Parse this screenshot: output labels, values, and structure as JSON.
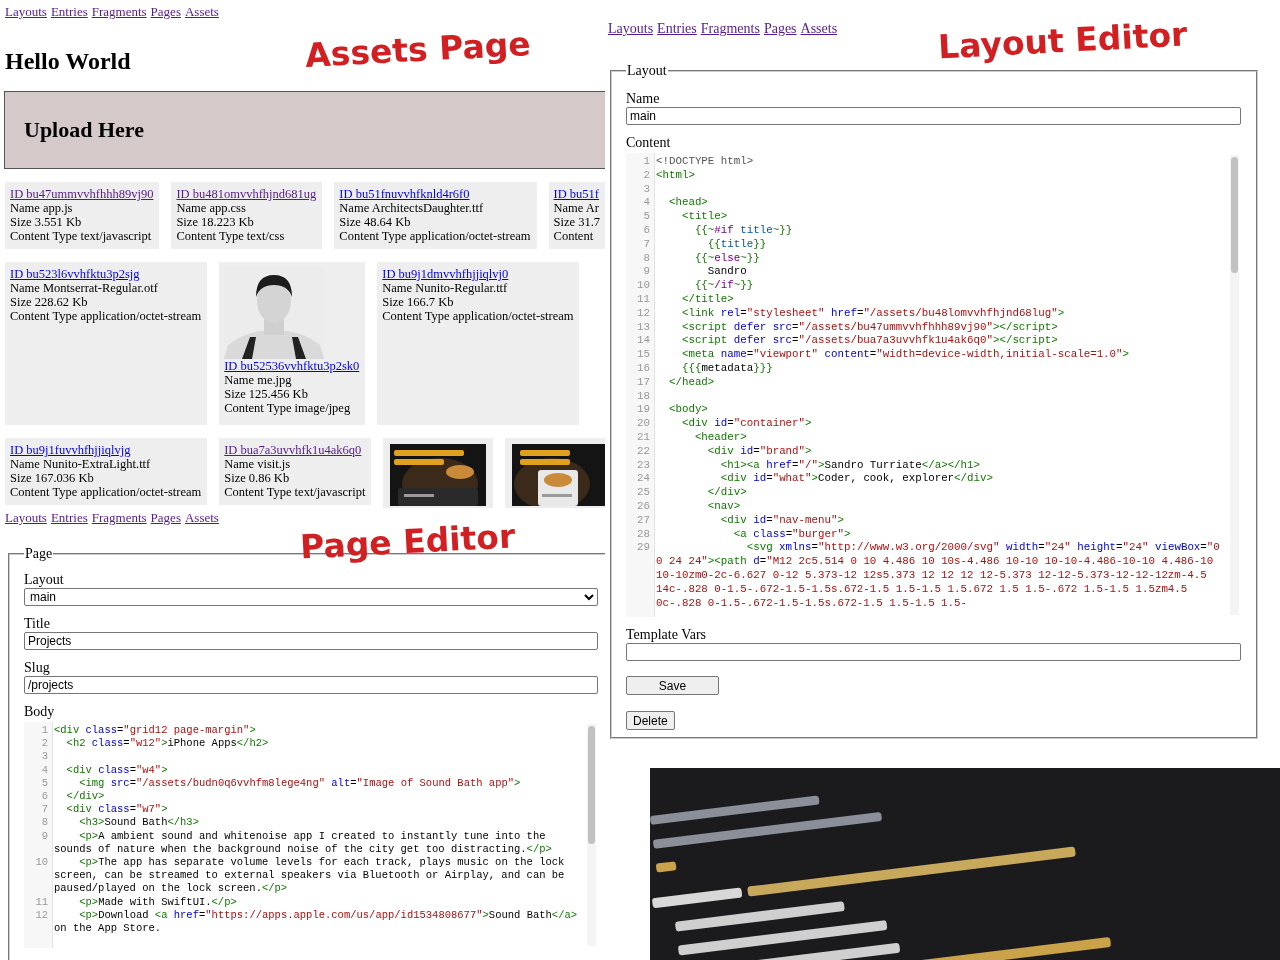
{
  "assets_page": {
    "nav": [
      "Layouts",
      "Entries",
      "Fragments",
      "Pages",
      "Assets"
    ],
    "annotation": "Assets Page",
    "heading": "Hello World",
    "upload_label": "Upload Here",
    "asset_rows": [
      [
        {
          "kind": "file",
          "id": "ID bu47ummvvhfhhh89vj90",
          "visited": true,
          "name": "Name app.js",
          "size": "Size 3.551 Kb",
          "content_type": "Content Type text/javascript"
        },
        {
          "kind": "file",
          "id": "ID bu481omvvhfhjnd681ug",
          "visited": true,
          "name": "Name app.css",
          "size": "Size 18.223 Kb",
          "content_type": "Content Type text/css"
        },
        {
          "kind": "file",
          "id": "ID bu51fnuvvhfknld4r6f0",
          "visited": false,
          "name": "Name ArchitectsDaughter.ttf",
          "size": "Size 48.64 Kb",
          "content_type": "Content Type application/octet-stream"
        },
        {
          "kind": "file",
          "id": "ID bu51f",
          "visited": false,
          "name": "Name Ar",
          "size": "Size 31.7",
          "content_type": "Content"
        }
      ],
      [
        {
          "kind": "file",
          "id": "ID bu523l6vvhfktu3p2sjg",
          "visited": false,
          "name": "Name Montserrat-Regular.otf",
          "size": "Size 228.62 Kb",
          "content_type": "Content Type application/octet-stream"
        },
        {
          "kind": "image_file",
          "id": "ID bu52536vvhfktu3p2sk0",
          "visited": false,
          "name": "Name me.jpg",
          "size": "Size 125.456 Kb",
          "content_type": "Content Type image/jpeg"
        },
        {
          "kind": "file",
          "id": "ID bu9j1dmvvhfhjjiqlvj0",
          "visited": false,
          "name": "Name Nunito-Regular.ttf",
          "size": "Size 166.7 Kb",
          "content_type": "Content Type application/octet-stream"
        }
      ],
      [
        {
          "kind": "file",
          "id": "ID bu9j1fuvvhfhjjiqlvjg",
          "visited": false,
          "name": "Name Nunito-ExtraLight.ttf",
          "size": "Size 167.036 Kb",
          "content_type": "Content Type application/octet-stream"
        },
        {
          "kind": "file",
          "id": "ID bua7a3uvvhfk1u4ak6q0",
          "visited": true,
          "name": "Name visit.js",
          "size": "Size 0.86 Kb",
          "content_type": "Content Type text/javascript"
        },
        {
          "kind": "picture"
        },
        {
          "kind": "picture"
        }
      ]
    ]
  },
  "layout_editor": {
    "nav": [
      "Layouts",
      "Entries",
      "Fragments",
      "Pages",
      "Assets"
    ],
    "annotation": "Layout Editor",
    "legend": "Layout",
    "name_label": "Name",
    "name_value": "main",
    "content_label": "Content",
    "content_lines": [
      {
        "number": "1",
        "tokens": [
          {
            "kind": "meta",
            "text": "<!DOCTYPE html>"
          }
        ]
      },
      {
        "number": "2",
        "tokens": [
          {
            "kind": "tag",
            "text": "<html>"
          }
        ]
      },
      {
        "number": "3"
      },
      {
        "number": "4",
        "tokens": [
          {
            "kind": "tag",
            "text": "  <head>"
          }
        ]
      },
      {
        "number": "5",
        "tokens": [
          {
            "kind": "tag",
            "text": "    <title>"
          }
        ]
      },
      {
        "number": "6",
        "tokens": [
          {
            "kind": "tag",
            "text": "      {{~"
          },
          {
            "kind": "keyword",
            "text": "#if"
          },
          {
            "kind": "variable",
            "text": " title"
          },
          {
            "kind": "tag",
            "text": "~}}"
          }
        ]
      },
      {
        "number": "7",
        "tokens": [
          {
            "kind": "tag",
            "text": "        {{"
          },
          {
            "kind": "variable",
            "text": "title"
          },
          {
            "kind": "tag",
            "text": "}}"
          }
        ]
      },
      {
        "number": "8",
        "tokens": [
          {
            "kind": "tag",
            "text": "      {{~"
          },
          {
            "kind": "keyword",
            "text": "else"
          },
          {
            "kind": "tag",
            "text": "~}}"
          }
        ]
      },
      {
        "number": "9",
        "tokens": [
          {
            "kind": "text",
            "text": "        Sandro"
          }
        ]
      },
      {
        "number": "10",
        "tokens": [
          {
            "kind": "tag",
            "text": "      {{~"
          },
          {
            "kind": "keyword",
            "text": "/if"
          },
          {
            "kind": "tag",
            "text": "~}}"
          }
        ]
      },
      {
        "number": "11",
        "tokens": [
          {
            "kind": "tag",
            "text": "    </title>"
          }
        ]
      },
      {
        "number": "12",
        "tokens": [
          {
            "kind": "tag",
            "text": "    <link"
          },
          {
            "kind": "attr",
            "text": " rel"
          },
          {
            "kind": "text",
            "text": "="
          },
          {
            "kind": "string",
            "text": "\"stylesheet\""
          },
          {
            "kind": "attr",
            "text": " href"
          },
          {
            "kind": "text",
            "text": "="
          },
          {
            "kind": "string",
            "text": "\"/assets/bu48lomvvhfhjnd68lug\""
          },
          {
            "kind": "tag",
            "text": ">"
          }
        ]
      },
      {
        "number": "13",
        "tokens": [
          {
            "kind": "tag",
            "text": "    <script"
          },
          {
            "kind": "attr",
            "text": " defer src"
          },
          {
            "kind": "text",
            "text": "="
          },
          {
            "kind": "string",
            "text": "\"/assets/bu47ummvvhfhhh89vj90\""
          },
          {
            "kind": "tag",
            "text": "></script>"
          }
        ]
      },
      {
        "number": "14",
        "tokens": [
          {
            "kind": "tag",
            "text": "    <script"
          },
          {
            "kind": "attr",
            "text": " defer src"
          },
          {
            "kind": "text",
            "text": "="
          },
          {
            "kind": "string",
            "text": "\"/assets/bua7a3uvvhfk1u4ak6q0\""
          },
          {
            "kind": "tag",
            "text": "></script>"
          }
        ]
      },
      {
        "number": "15",
        "tokens": [
          {
            "kind": "tag",
            "text": "    <meta"
          },
          {
            "kind": "attr",
            "text": " name"
          },
          {
            "kind": "text",
            "text": "="
          },
          {
            "kind": "string",
            "text": "\"viewport\""
          },
          {
            "kind": "attr",
            "text": " content"
          },
          {
            "kind": "text",
            "text": "="
          },
          {
            "kind": "string",
            "text": "\"width=device-width,initial-scale=1.0\""
          },
          {
            "kind": "tag",
            "text": ">"
          }
        ]
      },
      {
        "number": "16",
        "tokens": [
          {
            "kind": "tag",
            "text": "    {{{"
          },
          {
            "kind": "text",
            "text": "metadata"
          },
          {
            "kind": "tag",
            "text": "}}}"
          }
        ]
      },
      {
        "number": "17",
        "tokens": [
          {
            "kind": "tag",
            "text": "  </head>"
          }
        ]
      },
      {
        "number": "18"
      },
      {
        "number": "19",
        "tokens": [
          {
            "kind": "tag",
            "text": "  <body>"
          }
        ]
      },
      {
        "number": "20",
        "tokens": [
          {
            "kind": "tag",
            "text": "    <div"
          },
          {
            "kind": "attr",
            "text": " id"
          },
          {
            "kind": "text",
            "text": "="
          },
          {
            "kind": "string",
            "text": "\"container\""
          },
          {
            "kind": "tag",
            "text": ">"
          }
        ]
      },
      {
        "number": "21",
        "tokens": [
          {
            "kind": "tag",
            "text": "      <header>"
          }
        ]
      },
      {
        "number": "22",
        "tokens": [
          {
            "kind": "tag",
            "text": "        <div"
          },
          {
            "kind": "attr",
            "text": " id"
          },
          {
            "kind": "text",
            "text": "="
          },
          {
            "kind": "string",
            "text": "\"brand\""
          },
          {
            "kind": "tag",
            "text": ">"
          }
        ]
      },
      {
        "number": "23",
        "tokens": [
          {
            "kind": "tag",
            "text": "          <h1><a"
          },
          {
            "kind": "attr",
            "text": " href"
          },
          {
            "kind": "text",
            "text": "="
          },
          {
            "kind": "string",
            "text": "\"/\""
          },
          {
            "kind": "tag",
            "text": ">"
          },
          {
            "kind": "text",
            "text": "Sandro Turriate"
          },
          {
            "kind": "tag",
            "text": "</a></h1>"
          }
        ]
      },
      {
        "number": "24",
        "tokens": [
          {
            "kind": "tag",
            "text": "          <div"
          },
          {
            "kind": "attr",
            "text": " id"
          },
          {
            "kind": "text",
            "text": "="
          },
          {
            "kind": "string",
            "text": "\"what\""
          },
          {
            "kind": "tag",
            "text": ">"
          },
          {
            "kind": "text",
            "text": "Coder, cook, explorer"
          },
          {
            "kind": "tag",
            "text": "</div>"
          }
        ]
      },
      {
        "number": "25",
        "tokens": [
          {
            "kind": "tag",
            "text": "        </div>"
          }
        ]
      },
      {
        "number": "26",
        "tokens": [
          {
            "kind": "tag",
            "text": "        <nav>"
          }
        ]
      },
      {
        "number": "27",
        "tokens": [
          {
            "kind": "tag",
            "text": "          <div"
          },
          {
            "kind": "attr",
            "text": " id"
          },
          {
            "kind": "text",
            "text": "="
          },
          {
            "kind": "string",
            "text": "\"nav-menu\""
          },
          {
            "kind": "tag",
            "text": ">"
          }
        ]
      },
      {
        "number": "28",
        "tokens": [
          {
            "kind": "tag",
            "text": "            <a"
          },
          {
            "kind": "attr",
            "text": " class"
          },
          {
            "kind": "text",
            "text": "="
          },
          {
            "kind": "string",
            "text": "\"burger\""
          },
          {
            "kind": "tag",
            "text": ">"
          }
        ]
      },
      {
        "number": "29",
        "tokens": [
          {
            "kind": "tag",
            "text": "              <svg"
          },
          {
            "kind": "attr",
            "text": " xmlns"
          },
          {
            "kind": "text",
            "text": "="
          },
          {
            "kind": "string",
            "text": "\"http://www.w3.org/2000/svg\""
          },
          {
            "kind": "attr",
            "text": " width"
          },
          {
            "kind": "text",
            "text": "="
          },
          {
            "kind": "string",
            "text": "\"24\""
          },
          {
            "kind": "attr",
            "text": " height"
          },
          {
            "kind": "text",
            "text": "="
          },
          {
            "kind": "string",
            "text": "\"24\""
          },
          {
            "kind": "attr",
            "text": " viewBox"
          },
          {
            "kind": "text",
            "text": "="
          },
          {
            "kind": "string",
            "text": "\"0 0 24 24\""
          },
          {
            "kind": "tag",
            "text": "><path"
          },
          {
            "kind": "attr",
            "text": " d"
          },
          {
            "kind": "text",
            "text": "="
          },
          {
            "kind": "string",
            "text": "\"M12 2c5.514 0 10 4.486 10 10s-4.486 10-10 10-10-4.486-10-10 4.486-10 10-10zm0-2c-6.627 0-12 5.373-12 12s5.373 12 12 12 12-5.373 12-12-5.373-12-12-12zm-4.5 14c-.828 0-1.5-.672-1.5-1.5s.672-1.5 1.5-1.5 1.5.672 1.5 1.5-.672 1.5-1.5 1.5zm4.5 0c-.828 0-1.5-.672-1.5-1.5s.672-1.5 1.5-1.5 1.5-"
          }
        ]
      }
    ],
    "template_vars_label": "Template Vars",
    "buttons": [
      "Save",
      "Delete"
    ]
  },
  "page_editor": {
    "nav": [
      "Layouts",
      "Entries",
      "Fragments",
      "Pages",
      "Assets"
    ],
    "annotation": "Page Editor",
    "legend": "Page",
    "layout_label": "Layout",
    "layout_value": "main",
    "title_label": "Title",
    "title_value": "Projects",
    "slug_label": "Slug",
    "slug_value": "/projects",
    "body_label": "Body",
    "body_lines": [
      {
        "number": "1",
        "tokens": [
          {
            "kind": "tag",
            "text": "<div"
          },
          {
            "kind": "attr",
            "text": " class"
          },
          {
            "kind": "text",
            "text": "="
          },
          {
            "kind": "string",
            "text": "\"grid12 page-margin\""
          },
          {
            "kind": "tag",
            "text": ">"
          }
        ]
      },
      {
        "number": "2",
        "tokens": [
          {
            "kind": "tag",
            "text": "  <h2"
          },
          {
            "kind": "attr",
            "text": " class"
          },
          {
            "kind": "text",
            "text": "="
          },
          {
            "kind": "string",
            "text": "\"w12\""
          },
          {
            "kind": "tag",
            "text": ">"
          },
          {
            "kind": "text",
            "text": "iPhone Apps"
          },
          {
            "kind": "tag",
            "text": "</h2>"
          }
        ]
      },
      {
        "number": "3"
      },
      {
        "number": "4",
        "tokens": [
          {
            "kind": "tag",
            "text": "  <div"
          },
          {
            "kind": "attr",
            "text": " class"
          },
          {
            "kind": "text",
            "text": "="
          },
          {
            "kind": "string",
            "text": "\"w4\""
          },
          {
            "kind": "tag",
            "text": ">"
          }
        ]
      },
      {
        "number": "5",
        "tokens": [
          {
            "kind": "tag",
            "text": "    <img"
          },
          {
            "kind": "attr",
            "text": " src"
          },
          {
            "kind": "text",
            "text": "="
          },
          {
            "kind": "string",
            "text": "\"/assets/budn0q6vvhfm8lege4ng\""
          },
          {
            "kind": "attr",
            "text": " alt"
          },
          {
            "kind": "text",
            "text": "="
          },
          {
            "kind": "string",
            "text": "\"Image of Sound Bath app\""
          },
          {
            "kind": "tag",
            "text": ">"
          }
        ]
      },
      {
        "number": "6",
        "tokens": [
          {
            "kind": "tag",
            "text": "  </div>"
          }
        ]
      },
      {
        "number": "7",
        "tokens": [
          {
            "kind": "tag",
            "text": "  <div"
          },
          {
            "kind": "attr",
            "text": " class"
          },
          {
            "kind": "text",
            "text": "="
          },
          {
            "kind": "string",
            "text": "\"w7\""
          },
          {
            "kind": "tag",
            "text": ">"
          }
        ]
      },
      {
        "number": "8",
        "tokens": [
          {
            "kind": "tag",
            "text": "    <h3>"
          },
          {
            "kind": "text",
            "text": "Sound Bath"
          },
          {
            "kind": "tag",
            "text": "</h3>"
          }
        ]
      },
      {
        "number": "9",
        "tokens": [
          {
            "kind": "tag",
            "text": "    <p>"
          },
          {
            "kind": "text",
            "text": "A ambient sound and whitenoise app I created to instantly tune into the sounds of nature when the background noise of the city get too distracting."
          },
          {
            "kind": "tag",
            "text": "</p>"
          }
        ]
      },
      {
        "number": "10",
        "tokens": [
          {
            "kind": "tag",
            "text": "    <p>"
          },
          {
            "kind": "text",
            "text": "The app has separate volume levels for each track, plays music on the lock screen, can be streamed to external speakers via Bluetooth or Airplay, and can be paused/played on the lock screen."
          },
          {
            "kind": "tag",
            "text": "</p>"
          }
        ]
      },
      {
        "number": "11",
        "tokens": [
          {
            "kind": "tag",
            "text": "    <p>"
          },
          {
            "kind": "text",
            "text": "Made with SwiftUI."
          },
          {
            "kind": "tag",
            "text": "</p>"
          }
        ]
      },
      {
        "number": "12",
        "tokens": [
          {
            "kind": "tag",
            "text": "    <p>"
          },
          {
            "kind": "text",
            "text": "Download "
          },
          {
            "kind": "tag",
            "text": "<a"
          },
          {
            "kind": "attr",
            "text": " href"
          },
          {
            "kind": "text",
            "text": "="
          },
          {
            "kind": "string",
            "text": "\"https://apps.apple.com/us/app/id1534808677\""
          },
          {
            "kind": "tag",
            "text": ">"
          },
          {
            "kind": "text",
            "text": "Sound Bath"
          },
          {
            "kind": "tag",
            "text": "</a>"
          },
          {
            "kind": "text",
            "text": " on the App Store."
          }
        ]
      }
    ]
  },
  "code_photo": {
    "kind": "picture"
  }
}
